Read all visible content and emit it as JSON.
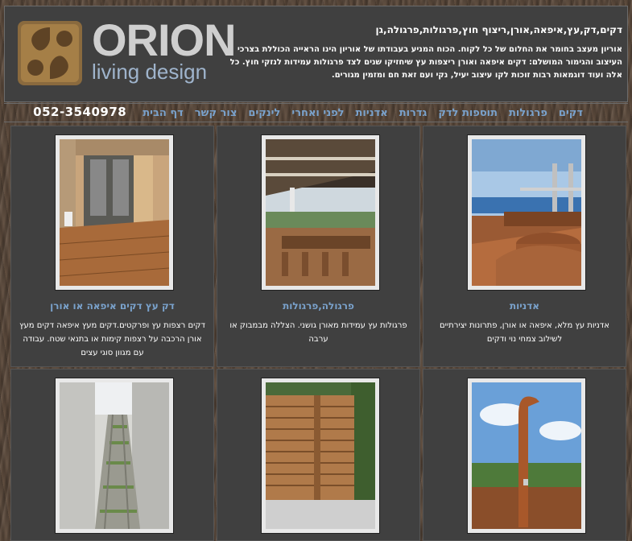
{
  "logo": {
    "name": "ORION",
    "tagline": "living design"
  },
  "header": {
    "title": "דקים,דק,עץ,איפאה,אורן,ריצוף חוץ,פרגולות,פרגולה,גן",
    "description": "אוריון מעצב בחומר את החלום של כל לקוח. הכוח המניע בעבודתו של אוריון הינו הראייה הכוללת בצרכי העיצוב והגימור המושלם: דקים איפאה ואורן ריצפות עץ שיחזיקו שנים לצד פרגולות עמידות לנזקי חוץ. כל אלה ועוד דוגמאות רבות זוכות לקו עיצוב יעיל, נקי ועם זאת חם ומזמין מגורים."
  },
  "nav": {
    "items": [
      "דקים",
      "פרגולות",
      "תוספות לדק",
      "גדרות",
      "אדניות",
      "לפני ואחרי",
      "לינקים",
      "צור קשר",
      "דף הבית"
    ],
    "phone": "052-3540978"
  },
  "cards": [
    {
      "title": "אדניות",
      "desc": "אדניות עץ מלא, איפאה או אורן, פתרונות יצירתיים לשילוב צמחי נוי ודקים",
      "photo_icon": "planter-photo"
    },
    {
      "title": "פרגולה,פרגולות",
      "desc": "פרגולות עץ עמידות מאורן גושני. הצללה מבמבוק או ערבה",
      "photo_icon": "pergola-photo"
    },
    {
      "title": "דק עץ דקים איפאה או אורן",
      "desc": "דקים רצפות עץ ופרקטים.דקים מעץ איפאה דקים מעץ אורן הרכבה על רצפות קימות או בתנאי שטח. עבודה עם מגוון סוגי עצים",
      "photo_icon": "deck-photo"
    },
    {
      "title": "",
      "desc": "",
      "photo_icon": "outdoor-shower-photo"
    },
    {
      "title": "",
      "desc": "",
      "photo_icon": "wood-fence-photo"
    },
    {
      "title": "",
      "desc": "",
      "photo_icon": "deck-frame-photo"
    }
  ]
}
